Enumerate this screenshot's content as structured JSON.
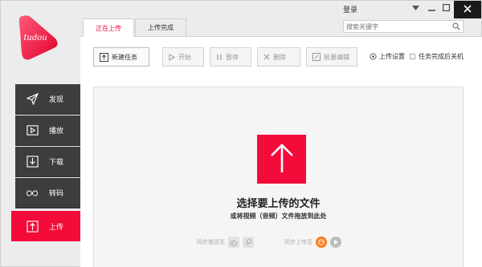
{
  "app": {
    "logo_text": "i tudou",
    "login_label": "登录",
    "search_placeholder": "搜索关键字"
  },
  "sidebar": {
    "items": [
      {
        "label": "发现",
        "icon": "send-icon"
      },
      {
        "label": "播放",
        "icon": "play-icon"
      },
      {
        "label": "下载",
        "icon": "download-icon"
      },
      {
        "label": "转码",
        "icon": "infinity-icon"
      },
      {
        "label": "上传",
        "icon": "upload-icon",
        "active": true
      }
    ]
  },
  "tabs": [
    {
      "label": "正在上传",
      "active": true
    },
    {
      "label": "上传完成",
      "active": false
    }
  ],
  "toolbar": {
    "new_task": "新建任务",
    "start": "开始",
    "pause": "暂停",
    "delete": "删除",
    "batch_edit": "批量编辑",
    "upload_settings": "上传设置",
    "shutdown_option": "任务完成后关机"
  },
  "dropzone": {
    "title": "选择要上传的文件",
    "subtitle": "或将视频（音频）文件拖放到此处",
    "sync_to": "同步推送至",
    "sync_upload_to": "同步上传至"
  },
  "colors": {
    "accent": "#f30b3a",
    "sidebar_bg": "#3d3d3d",
    "content_bg": "#f5f5f5"
  }
}
